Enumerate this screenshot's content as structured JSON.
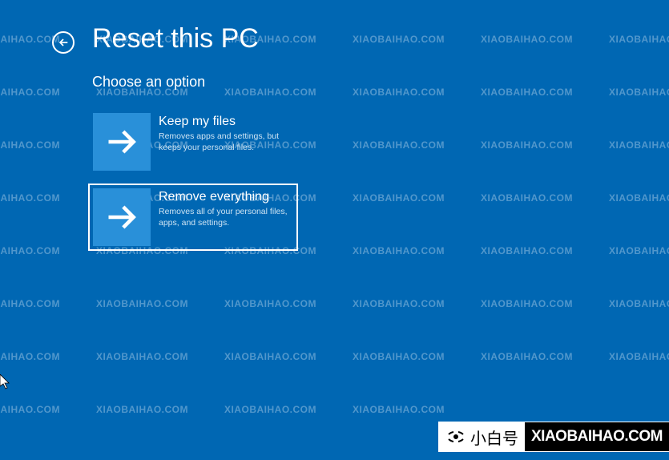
{
  "page_title": "Reset this PC",
  "subtitle": "Choose an option",
  "options": [
    {
      "title": "Keep my files",
      "description": "Removes apps and settings, but keeps your personal files.",
      "selected": false
    },
    {
      "title": "Remove everything",
      "description": "Removes all of your personal files, apps, and settings.",
      "selected": true
    }
  ],
  "watermark_text": "XIAOBAIHAO.COM",
  "banner": {
    "chinese": "小白号",
    "domain": "XIAOBAIHAO.COM"
  }
}
